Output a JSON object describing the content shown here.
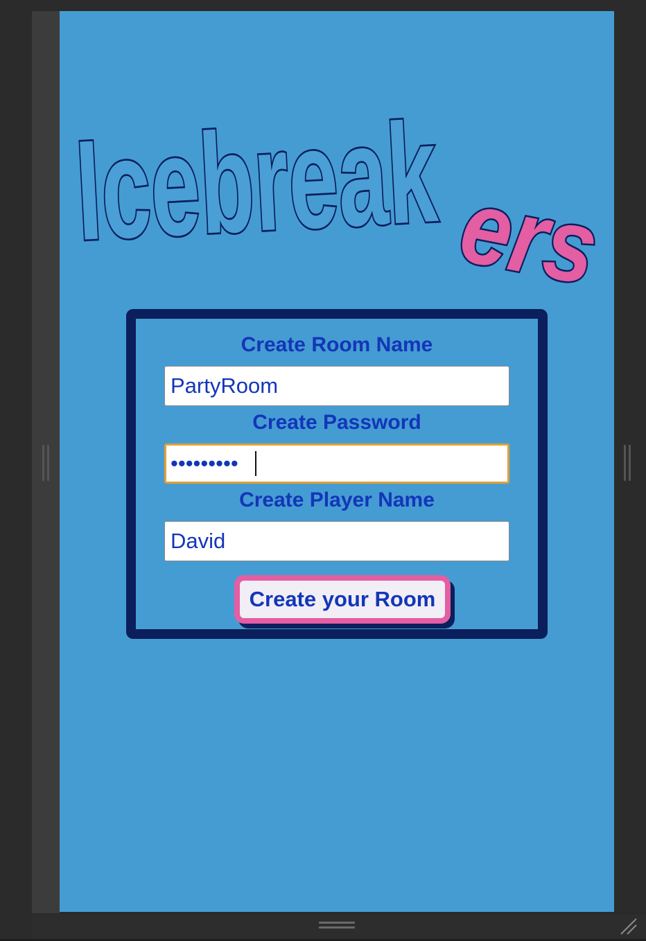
{
  "app": {
    "logo_text_main": "Icebreak",
    "logo_text_accent": "ers"
  },
  "form": {
    "room_label": "Create Room Name",
    "room_value": "PartyRoom",
    "password_label": "Create Password",
    "password_value": "partypass",
    "player_label": "Create Player Name",
    "player_value": "David",
    "submit_label": "Create your Room"
  },
  "colors": {
    "background": "#459cd3",
    "accent_pink": "#e35ea3",
    "navy": "#0b1f5c",
    "text_blue": "#1336b8",
    "focus_ring": "#e5a033"
  }
}
